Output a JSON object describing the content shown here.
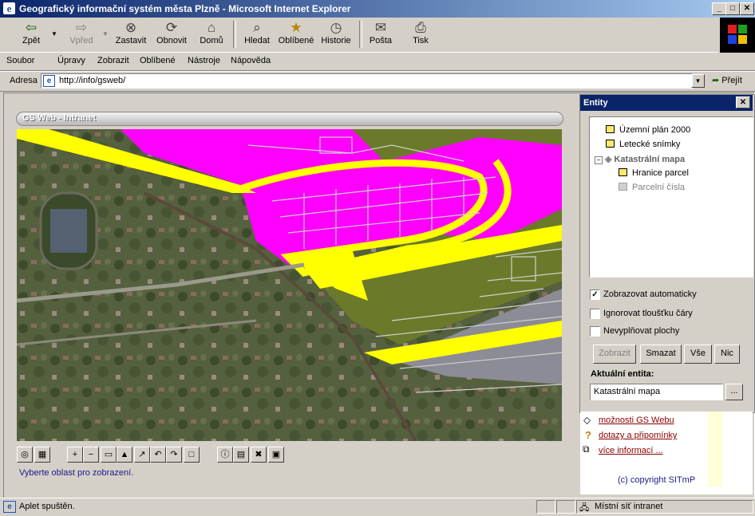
{
  "window": {
    "title": "Geografický informační systém města Plzně - Microsoft Internet Explorer"
  },
  "toolbar": {
    "back": "Zpět",
    "forward": "Vpřed",
    "stop": "Zastavit",
    "refresh": "Obnovit",
    "home": "Domů",
    "search": "Hledat",
    "favorites": "Oblíbené",
    "history": "Historie",
    "mail": "Pošta",
    "print": "Tisk"
  },
  "menu": [
    "Soubor",
    "Úpravy",
    "Zobrazit",
    "Oblíbené",
    "Nástroje",
    "Nápověda"
  ],
  "address": {
    "label": "Adresa",
    "url": "http://info/gsweb/",
    "go": "Přejít"
  },
  "gsweb": {
    "header": "GS Web - Intranet",
    "hint": "Vyberte oblast pro zobrazení."
  },
  "entity_panel": {
    "title": "Entity",
    "tree": [
      {
        "label": "Územní plán 2000"
      },
      {
        "label": "Letecké snímky"
      },
      {
        "label": "Katastrální mapa"
      },
      {
        "label": "Hranice parcel"
      },
      {
        "label": "Parcelní čísla"
      }
    ],
    "options": [
      {
        "label": "Zobrazovat automaticky",
        "checked": true
      },
      {
        "label": "Ignorovat tloušťku čáry",
        "checked": false
      },
      {
        "label": "Nevyplňovat plochy",
        "checked": false
      }
    ],
    "buttons": {
      "show": "Zobrazit",
      "delete": "Smazat",
      "all": "Vše",
      "none": "Nic"
    },
    "current_label": "Aktuální entita:",
    "current_value": "Katastrální mapa",
    "browse": "..."
  },
  "links": {
    "gsweb_options": "možnosti GS Webu",
    "questions": "dotazy a připomínky",
    "more_info": "více informací ...",
    "copyright": "(c) copyright SITmP"
  },
  "status": {
    "text": "Aplet spuštěn.",
    "zone": "Místní síť intranet"
  },
  "colors": {
    "zoning": "#ff00ff",
    "roads": "#ffff00",
    "green": "#6b7a2a",
    "water": "#8c8c96",
    "titlebar": "#0a246a"
  }
}
